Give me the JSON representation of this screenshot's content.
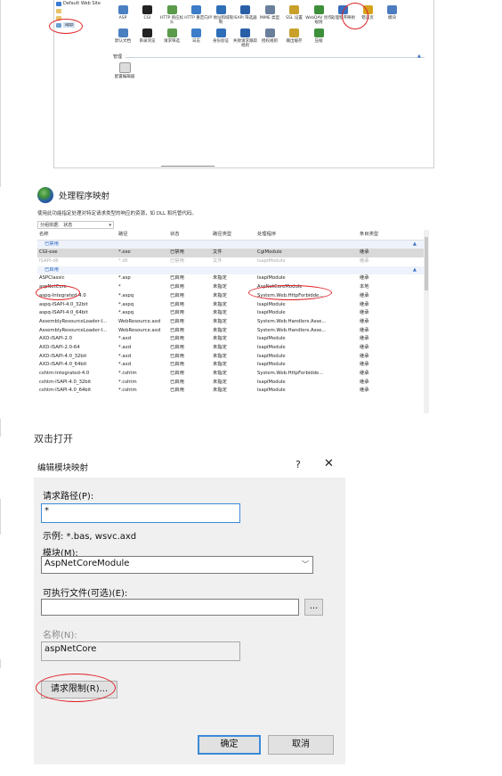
{
  "iis": {
    "tree": [
      "Default Web Site",
      "",
      "",
      "app"
    ],
    "features_row1": [
      "ASP",
      "CGI",
      "HTTP 响应标头",
      "HTTP 重定向",
      "IP 地址和域限制",
      "ISAPI 筛选器",
      "MIME 类型",
      "SSL 设置",
      "WebDAV 创作规则",
      "处理程序映射",
      "错误页",
      "模块"
    ],
    "features_row2": [
      "默认文档",
      "目录浏览",
      "请求筛选",
      "日志",
      "身份验证",
      "失败请求跟踪规则",
      "授权规则",
      "输出缓存",
      "压缩"
    ],
    "manage_header": "管理",
    "manage_items": [
      "配置编辑器"
    ]
  },
  "handler_mappings": {
    "title": "处理程序映射",
    "description": "使用此功能指定处理对特定请求类型的响应的资源，如 DLL 和托管代码。",
    "group_by_label": "分组依据:",
    "group_by_value": "状态",
    "columns": [
      "名称",
      "路径",
      "状态",
      "路径类型",
      "处理程序",
      "条目类型"
    ],
    "disabled_section": "已禁用",
    "disabled_rows": [
      [
        "CGI-exe",
        "*.exe",
        "已禁用",
        "文件",
        "CgiModule",
        "继承"
      ],
      [
        "ISAPI-dll",
        "*.dll",
        "已禁用",
        "文件",
        "IsapiModule",
        "继承"
      ]
    ],
    "enabled_section": "已启用",
    "enabled_rows": [
      [
        "ASPClassic",
        "*.asp",
        "已启用",
        "未指定",
        "IsapiModule",
        "继承"
      ],
      [
        "aspNetCore",
        "*",
        "已启用",
        "未指定",
        "AspNetCoreModule",
        "本地"
      ],
      [
        "aspq-Integrated-4.0",
        "*.aspq",
        "已启用",
        "未指定",
        "System.Web.HttpForbidde...",
        "继承"
      ],
      [
        "aspq-ISAPI-4.0_32bit",
        "*.aspq",
        "已启用",
        "未指定",
        "IsapiModule",
        "继承"
      ],
      [
        "aspq-ISAPI-4.0_64bit",
        "*.aspq",
        "已启用",
        "未指定",
        "IsapiModule",
        "继承"
      ],
      [
        "AssemblyResourceLoader-I...",
        "WebResource.axd",
        "已启用",
        "未指定",
        "System.Web.Handlers.Asse...",
        "继承"
      ],
      [
        "AssemblyResourceLoader-I...",
        "WebResource.axd",
        "已启用",
        "未指定",
        "System.Web.Handlers.Asse...",
        "继承"
      ],
      [
        "AXD-ISAPI-2.0",
        "*.axd",
        "已启用",
        "未指定",
        "IsapiModule",
        "继承"
      ],
      [
        "AXD-ISAPI-2.0-64",
        "*.axd",
        "已启用",
        "未指定",
        "IsapiModule",
        "继承"
      ],
      [
        "AXD-ISAPI-4.0_32bit",
        "*.axd",
        "已启用",
        "未指定",
        "IsapiModule",
        "继承"
      ],
      [
        "AXD-ISAPI-4.0_64bit",
        "*.axd",
        "已启用",
        "未指定",
        "IsapiModule",
        "继承"
      ],
      [
        "cshtm-Integrated-4.0",
        "*.cshtm",
        "已启用",
        "未指定",
        "System.Web.HttpForbidde...",
        "继承"
      ],
      [
        "cshtm-ISAPI-4.0_32bit",
        "*.cshtm",
        "已启用",
        "未指定",
        "IsapiModule",
        "继承"
      ],
      [
        "cshtm-ISAPI-4.0_64bit",
        "*.cshtm",
        "已启用",
        "未指定",
        "IsapiModule",
        "继承"
      ]
    ]
  },
  "caption": "双击打开",
  "dialog": {
    "title": "编辑模块映射",
    "help": "?",
    "close": "✕",
    "request_path_label": "请求路径(P):",
    "request_path_value": "*",
    "example_text": "示例: *.bas, wsvc.axd",
    "module_label": "模块(M):",
    "module_value": "AspNetCoreModule",
    "executable_label": "可执行文件(可选)(E):",
    "executable_value": "",
    "browse_label": "...",
    "name_label": "名称(N):",
    "name_value": "aspNetCore",
    "request_restrictions_label": "请求限制(R)...",
    "ok_label": "确定",
    "cancel_label": "取消"
  },
  "colors": {
    "annotation_red": "#e0252a",
    "accent_blue": "#3c8ad8",
    "dialog_bg": "#f0f0f0"
  }
}
